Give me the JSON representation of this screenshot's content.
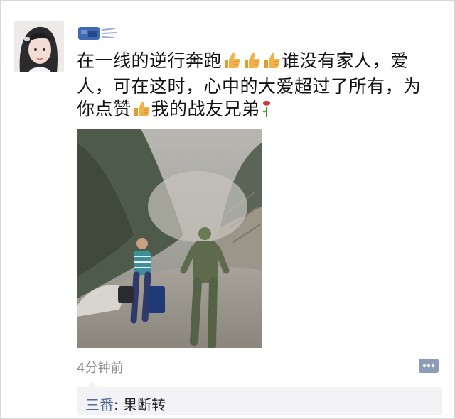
{
  "post": {
    "text_parts": {
      "p1": "在一线的逆行奔跑",
      "p2": "谁没有家人，爱人，可在这时，心中的大爱超过了所有，为你点赞",
      "p3": "我的战友兄弟"
    },
    "icons": [
      "thumbs-up-icon",
      "rose-icon"
    ],
    "timestamp": "4分钟前"
  },
  "comment": {
    "author": "三番",
    "separator": ": ",
    "text": "果断转"
  },
  "colors": {
    "link": "#576b95",
    "meta": "#8c8c8c",
    "comment_bg": "#f3f3f5",
    "thumb": "#f2b24a"
  }
}
